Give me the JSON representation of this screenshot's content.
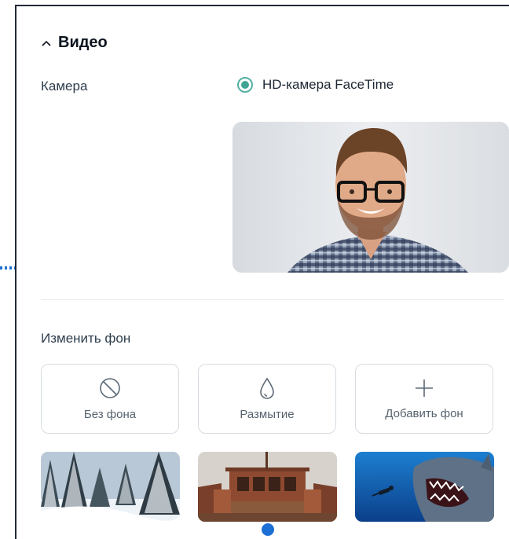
{
  "section": {
    "title": "Видео"
  },
  "camera": {
    "label": "Камера",
    "selected_option": "HD-камера FaceTime"
  },
  "background": {
    "label": "Изменить фон",
    "options": [
      {
        "label": "Без фона",
        "icon": "no-background-icon"
      },
      {
        "label": "Размытие",
        "icon": "blur-drop-icon"
      },
      {
        "label": "Добавить фон",
        "icon": "plus-icon"
      }
    ],
    "presets": [
      "snowy-forest",
      "ship-deck",
      "shark-underwater"
    ]
  },
  "colors": {
    "accent": "#3fa595",
    "handle": "#1d6fd6",
    "border": "#d6dce2"
  }
}
